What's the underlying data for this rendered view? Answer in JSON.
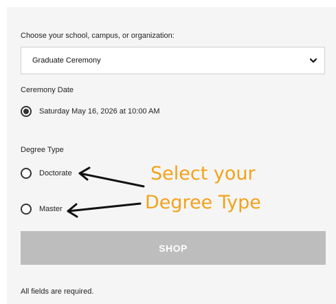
{
  "form": {
    "school_label": "Choose your school, campus, or organization:",
    "school_selected": "Graduate Ceremony",
    "ceremony_date_label": "Ceremony Date",
    "ceremony_option": "Saturday May 16, 2026 at 10:00 AM",
    "degree_type_label": "Degree Type",
    "degree_options": [
      "Doctorate",
      "Master"
    ],
    "shop_label": "SHOP",
    "required_note": "All fields are required."
  },
  "annotation": {
    "line1": "Select your",
    "line2": "Degree Type",
    "color": "#f2a21a"
  },
  "colors": {
    "panel_bg": "#f5f5f5",
    "button_bg": "#bdbdbd",
    "text": "#222222"
  }
}
